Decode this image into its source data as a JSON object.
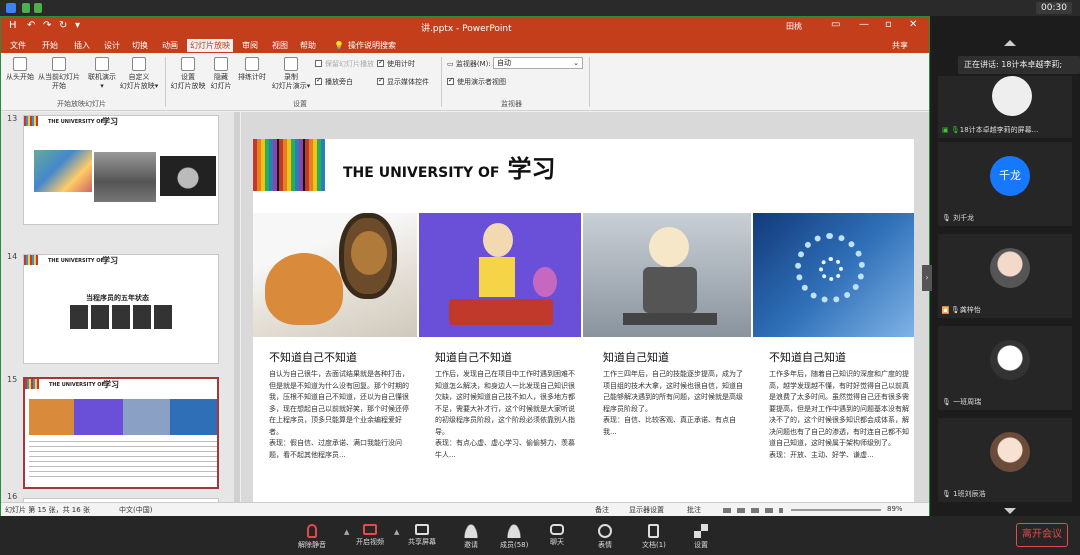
{
  "system": {
    "time": "00:30"
  },
  "app": {
    "doc_title": "讲.pptx - PowerPoint",
    "user": "田桃",
    "quick_access": [
      "H",
      "↶",
      "↷",
      "↻",
      "▾"
    ],
    "window_buttons": [
      "▭",
      "—",
      "▫",
      "✕"
    ],
    "menu": [
      "文件",
      "开始",
      "插入",
      "设计",
      "切换",
      "动画",
      "幻灯片放映",
      "审阅",
      "视图",
      "帮助",
      "操作说明搜索"
    ],
    "share": "共享"
  },
  "ribbon": {
    "b1": "从头开始",
    "b2a": "从当前幻灯片",
    "b2b": "开始",
    "b3a": "联机演示",
    "b3b": "▾",
    "b4a": "自定义",
    "b4b": "幻灯片放映▾",
    "g1": "开始放映幻灯片",
    "b5a": "设置",
    "b5b": "幻灯片放映",
    "b6a": "隐藏",
    "b6b": "幻灯片",
    "b7": "排练计时",
    "b8a": "录制",
    "b8b": "幻灯片演示▾",
    "c1": "保留幻灯片播放",
    "c2": "播放旁白",
    "c3": "使用计时",
    "c4": "显示媒体控件",
    "g2": "设置",
    "mon_label": "监视器(M):",
    "mon_value": "自动",
    "mon_arrow": "⌄",
    "c5": "使用演示者视图",
    "g3": "监视器"
  },
  "thumbs": {
    "n13": "13",
    "n14": "14",
    "n15": "15",
    "n16": "16",
    "t13_head": "THE UNIVERSITY OF",
    "t13_big": "学习",
    "t14_head": "THE UNIVERSITY OF",
    "t14_big": "学习",
    "t14_title": "当程序员的五年状态",
    "t15_head": "THE UNIVERSITY OF",
    "t15_big": "学习"
  },
  "slide": {
    "title": "THE UNIVERSITY OF",
    "title_big": "学习",
    "columns": [
      {
        "title": "不知道自己不知道",
        "text": "自认为自己很牛，去面试结果就是各种打击，但是就是不知道为什么没有回复。那个时期的我，压根不知道自己不知道，还以为自己懂很多，现在想起自己以前就好笑，那个时候还停在上程序员，顶多只能算是个业余编程爱好者。",
        "extra": "表现：假自信、过度承诺、满口我能行没问题，看不起其他程序员..."
      },
      {
        "title": "知道自己不知道",
        "text": "工作后，发现自己在项目中工作时遇到困难不知道怎么解决，和身边人一比发现自己知识很欠缺，这时候知道自己技不如人，很多地方都不足，需要大补才行，这个时候就是大家听说的初级程序员阶段，这个阶段必须依靠别人指导。",
        "extra": "表现：有点心虚、虚心学习、偷偷努力、羡慕牛人..."
      },
      {
        "title": "知道自己知道",
        "text": "工作三四年后，自己的技能逐步提高，成为了项目组的技术大拿，这时候也很自信，知道自己能够解决遇到的所有问题，这时候就是高级程序员阶段了。",
        "extra": "表现：自信、比较客观、真正承诺、有点自我..."
      },
      {
        "title": "不知道自己知道",
        "text": "工作多年后，随着自己知识的深度和广度的提高，越学发现越不懂，有时好觉得自己以前真是浪费了太多时间。虽然觉得自己还有很多需要提高，但是对工作中遇到的问题基本没有解决不了的，这个时候很多知识都会成体系，解决问题也有了自己的渗透，有时连自己都不知道自己知道，这时候属于架构师级别了。",
        "extra": "表现：开放、主动、好学、谦虚..."
      }
    ]
  },
  "status": {
    "left": "幻灯片 第 15 张，共 16 张",
    "lang": "中文(中国)",
    "notes": "备注",
    "display": "显示器设置",
    "comments": "批注",
    "zoom": "89%"
  },
  "meeting": {
    "speaking": "正在讲话: 18计本卓越李莉;",
    "p1": "18计本卓越李莉的屏幕...",
    "p2_avatar": "千龙",
    "p2": "刘千龙",
    "p3": "龚梓怡",
    "p4": "一班周瑞",
    "p5": "1班刘辰浩"
  },
  "bottom": {
    "mute": "解除静音",
    "video": "开启视频",
    "share": "共享屏幕",
    "invite": "邀请",
    "members": "成员(58)",
    "chat": "聊天",
    "react": "表情",
    "docs": "文档(1)",
    "settings": "设置",
    "leave": "离开会议"
  },
  "colors": {
    "ppt_red": "#c43e1c",
    "accent_green": "#2b8a3e",
    "leave_red": "#e5484d",
    "zoom_blue": "#1677ff"
  }
}
